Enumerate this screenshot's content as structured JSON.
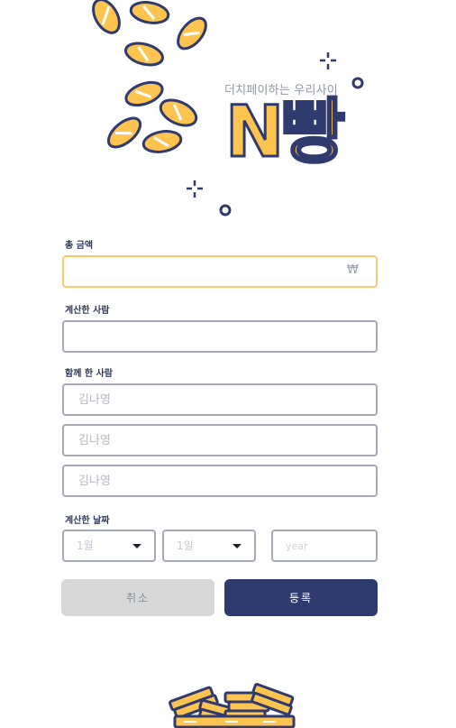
{
  "header": {
    "tagline": "더치페이하는 우리사이",
    "logo_text": "N빵"
  },
  "form": {
    "total_amount": {
      "label": "총 금액",
      "value": "",
      "placeholder": "",
      "currency_symbol": "₩"
    },
    "payer": {
      "label": "계산한 사람",
      "value": "",
      "placeholder": ""
    },
    "participants": {
      "label": "함께 한 사람",
      "fields": [
        {
          "value": "",
          "placeholder": "김나영"
        },
        {
          "value": "",
          "placeholder": "김나영"
        },
        {
          "value": "",
          "placeholder": "김나영"
        }
      ]
    },
    "date": {
      "label": "계산한 날짜",
      "month_select": "1월",
      "day_select": "1일",
      "year_placeholder": "year"
    }
  },
  "buttons": {
    "cancel_label": "취소",
    "submit_label": "등록"
  },
  "colors": {
    "brand_navy": "#2f3b6f",
    "brand_yellow": "#ffc44f",
    "border_gray": "#a4a8bb",
    "active_border": "#ffc76a"
  }
}
